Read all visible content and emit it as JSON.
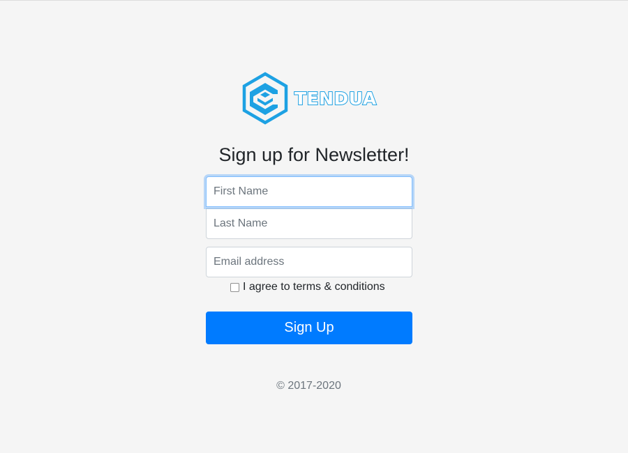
{
  "brand": {
    "name": "TENDUA",
    "color": "#1da1e3",
    "logo_icon": "hexagon-e-logo-icon"
  },
  "form": {
    "heading": "Sign up for Newsletter!",
    "first_name": {
      "placeholder": "First Name",
      "value": ""
    },
    "last_name": {
      "placeholder": "Last Name",
      "value": ""
    },
    "email": {
      "placeholder": "Email address",
      "value": ""
    },
    "terms": {
      "label": "I agree to terms & conditions",
      "checked": false
    },
    "submit_label": "Sign Up"
  },
  "footer": {
    "copyright": "© 2017-2020"
  },
  "colors": {
    "background": "#f5f5f5",
    "primary_button": "#007bff",
    "focus_ring": "#80bdff",
    "muted_text": "#6c757d"
  }
}
